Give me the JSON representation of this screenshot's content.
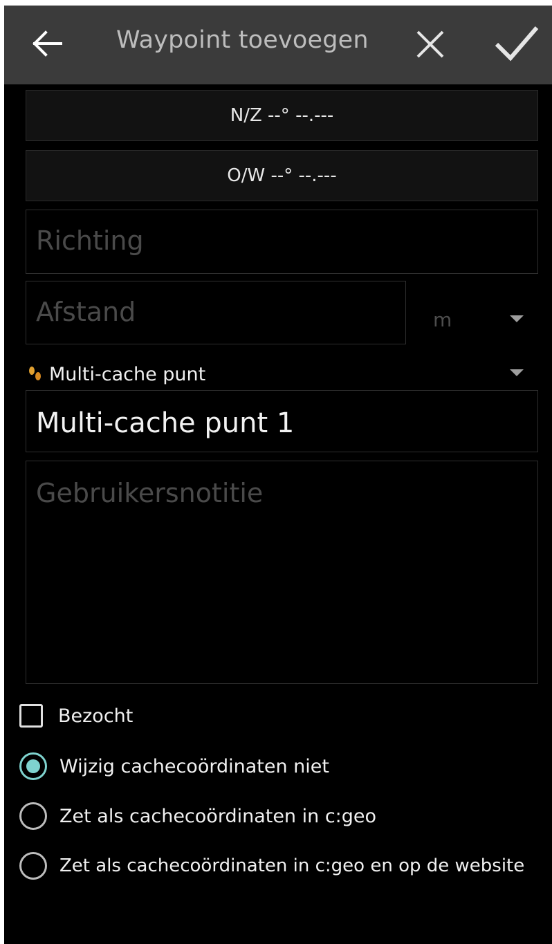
{
  "header": {
    "title": "Waypoint toevoegen",
    "back_icon": "arrow-left-icon",
    "cancel_icon": "close-icon",
    "confirm_icon": "check-icon"
  },
  "coordinates": {
    "latitude": "N/Z --° --.---",
    "longitude": "O/W --° --.---"
  },
  "direction": {
    "placeholder": "Richting"
  },
  "distance": {
    "placeholder": "Afstand",
    "unit": "m"
  },
  "waypoint_type": {
    "label": "Multi-cache punt",
    "icon": "footprints-icon"
  },
  "name": {
    "value": "Multi-cache punt 1"
  },
  "note": {
    "placeholder": "Gebruikersnotitie"
  },
  "visited": {
    "label": "Bezocht",
    "checked": false
  },
  "coordinate_options": [
    {
      "label": "Wijzig cachecoördinaten niet",
      "selected": true
    },
    {
      "label": "Zet als cachecoördinaten in c:geo",
      "selected": false
    },
    {
      "label": "Zet als cachecoördinaten in c:geo en op de website",
      "selected": false
    }
  ],
  "colors": {
    "accent": "#7fd3cf",
    "appbar": "#3b3b3b",
    "background": "#000000",
    "type_icon": "#e0a030"
  }
}
